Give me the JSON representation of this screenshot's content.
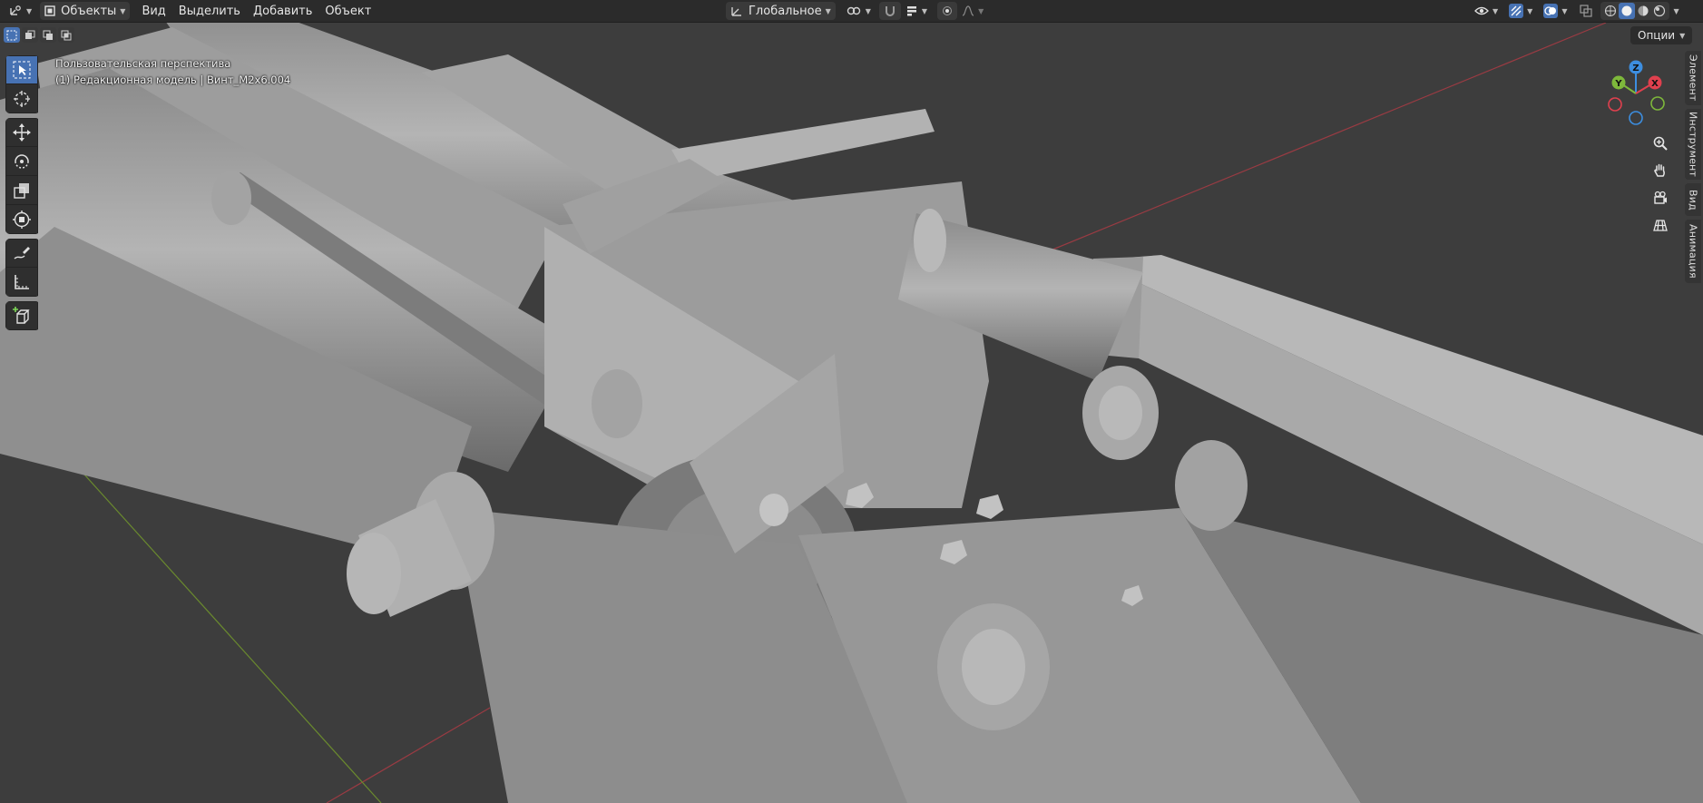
{
  "header": {
    "editor_type_icon": "3d-viewport-icon",
    "mode": {
      "label": "Объекты",
      "icon": "object-mode-icon"
    },
    "menus": [
      "Вид",
      "Выделить",
      "Добавить",
      "Объект"
    ],
    "transform_orientation": {
      "label": "Глобальное",
      "icon": "orientation-icon"
    },
    "pivot_icon": "pivot-link-icon",
    "snap_icon": "magnet-icon",
    "snap_target_icon": "snap-increment-icon",
    "proportional_icon": "proportional-edit-icon",
    "falloff_icon": "falloff-curve-icon",
    "right_icons": [
      "visibility-icon",
      "gizmo-icon",
      "overlay-icon",
      "xray-icon"
    ],
    "shading_modes": [
      "wireframe",
      "solid",
      "material",
      "rendered"
    ],
    "active_shading": "solid"
  },
  "viewport": {
    "view_name": "Пользовательская перспектива",
    "object_info": "(1) Редакционная модель | Винт_M2x6.004",
    "options_label": "Опции"
  },
  "gizmo": {
    "z_label": "Z",
    "y_label": "Y",
    "x_label": "X",
    "colors": {
      "x": "#e0404e",
      "y": "#7eb83b",
      "z": "#3d8ee0"
    }
  },
  "toolbar": {
    "tools": [
      "select-box",
      "cursor",
      "move",
      "rotate",
      "scale",
      "transform",
      "annotate",
      "measure",
      "add-cube"
    ],
    "active_tool": "select-box"
  },
  "nav_buttons": [
    "zoom-icon",
    "hand-pan-icon",
    "camera-icon",
    "grid-ortho-icon"
  ],
  "sidebar_tabs": [
    "Элемент",
    "Инструмент",
    "Вид",
    "Анимация"
  ],
  "colors": {
    "accent": "#4772b3",
    "header_bg": "#2b2b2b",
    "viewport_bg": "#3d3d3d"
  }
}
